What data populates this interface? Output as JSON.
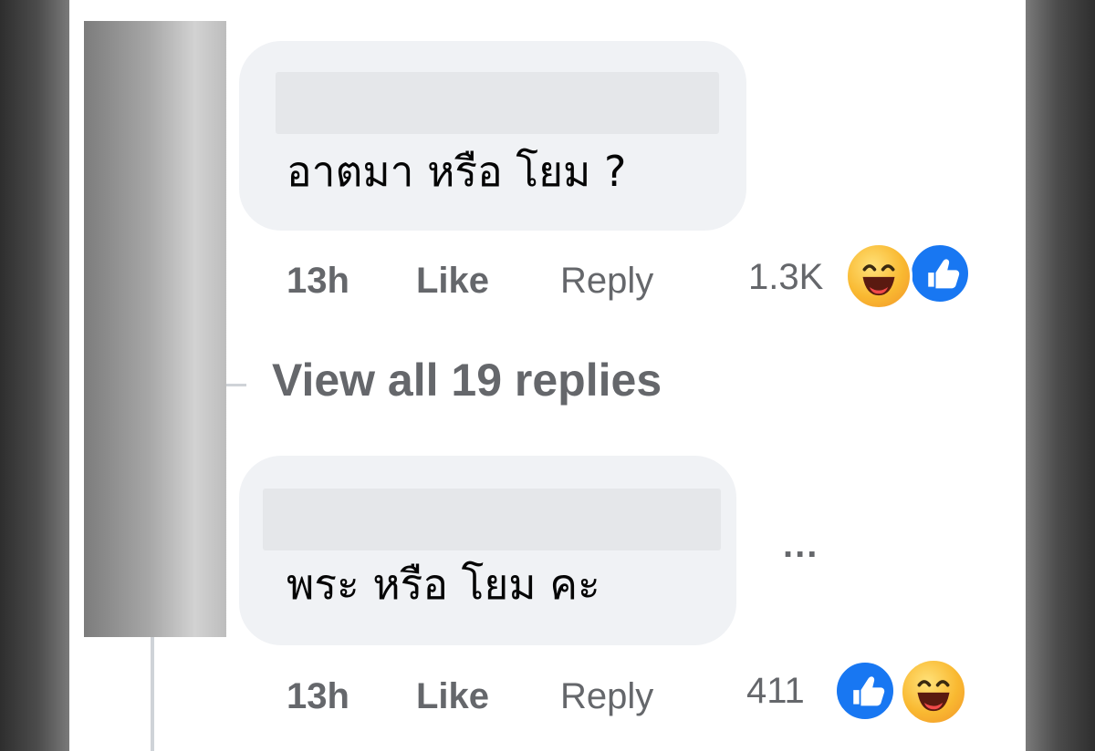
{
  "comments": [
    {
      "text": "อาตมา หรือ โยม ?",
      "time": "13h",
      "like_label": "Like",
      "reply_label": "Reply",
      "reaction_count": "1.3K",
      "reactions": [
        "haha-icon",
        "like-icon"
      ]
    },
    {
      "text": "พระ หรือ โยม คะ",
      "time": "13h",
      "like_label": "Like",
      "reply_label": "Reply",
      "reaction_count": "411",
      "reactions": [
        "like-icon",
        "haha-icon"
      ]
    }
  ],
  "view_replies_label": "View all 19 replies",
  "more_options_label": "...",
  "colors": {
    "bubble": "#f0f2f5",
    "meta_text": "#65676b",
    "like_blue": "#1877f2",
    "haha_yellow": "#f9b931"
  }
}
